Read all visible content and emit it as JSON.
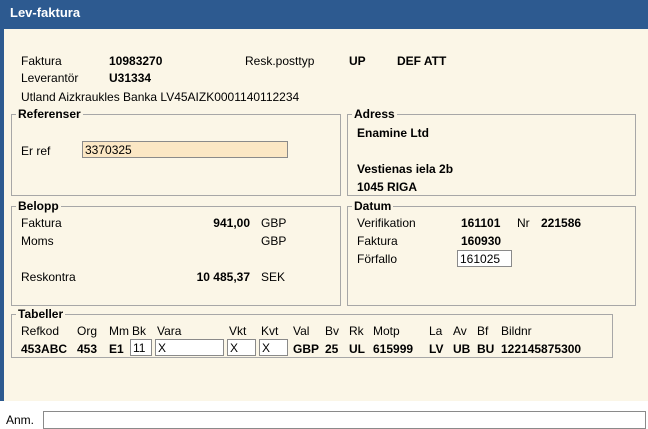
{
  "window": {
    "title": "Lev-faktura"
  },
  "header": {
    "faktura_label": "Faktura",
    "faktura_value": "10983270",
    "resk_label": "Resk.posttyp",
    "resk_value1": "UP",
    "resk_value2": "DEF ATT",
    "leverantor_label": "Leverantör",
    "leverantor_value": "U31334",
    "bank_line": "Utland Aizkraukles Banka LV45AIZK0001140112234"
  },
  "referenser": {
    "legend": "Referenser",
    "er_ref_label": "Er ref",
    "er_ref_value": "3370325"
  },
  "adress": {
    "legend": "Adress",
    "line1": "Enamine Ltd",
    "line2": "Vestienas iela 2b",
    "line3": "1045 RIGA"
  },
  "belopp": {
    "legend": "Belopp",
    "faktura_label": "Faktura",
    "faktura_value": "941,00",
    "faktura_currency": "GBP",
    "moms_label": "Moms",
    "moms_currency": "GBP",
    "reskontra_label": "Reskontra",
    "reskontra_value": "10 485,37",
    "reskontra_currency": "SEK"
  },
  "datum": {
    "legend": "Datum",
    "verifikation_label": "Verifikation",
    "verifikation_value": "161101",
    "nr_label": "Nr",
    "nr_value": "221586",
    "faktura_label": "Faktura",
    "faktura_value": "160930",
    "forfallo_label": "Förfallo",
    "forfallo_value": "161025"
  },
  "tabeller": {
    "legend": "Tabeller",
    "headers": {
      "refkod": "Refkod",
      "org": "Org",
      "mm": "Mm",
      "bk": "Bk",
      "vara": "Vara",
      "vkt": "Vkt",
      "kvt": "Kvt",
      "val": "Val",
      "bv": "Bv",
      "rk": "Rk",
      "motp": "Motp",
      "la": "La",
      "av": "Av",
      "bf": "Bf",
      "bildnr": "Bildnr"
    },
    "row": {
      "refkod": "453ABC",
      "org": "453",
      "mm": "E1",
      "bk": "11",
      "vara": "X",
      "vkt": "X",
      "kvt": "X",
      "val": "GBP",
      "bv": "25",
      "rk": "UL",
      "motp": "615999",
      "la": "LV",
      "av": "UB",
      "bf": "BU",
      "bildnr": "122145875300"
    }
  },
  "footer": {
    "anm_label": "Anm.",
    "anm_value": ""
  }
}
